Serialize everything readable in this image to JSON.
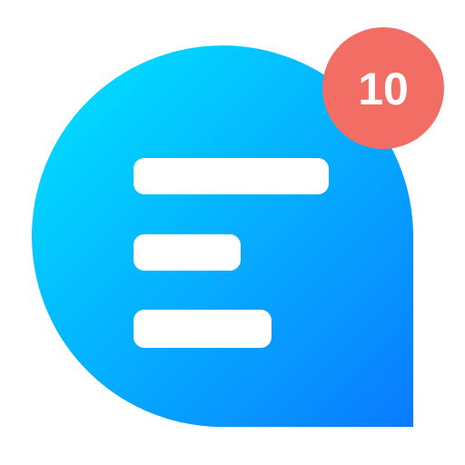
{
  "app_icon": {
    "icon": "chat-bubble-message-list-icon",
    "gradient_start": "#00E6FF",
    "gradient_end": "#0A7BFF",
    "line_color": "#FFFFFF",
    "list_lines": 3
  },
  "badge": {
    "count": "10",
    "color": "#F26D63",
    "text_color": "#FFFFFF"
  }
}
